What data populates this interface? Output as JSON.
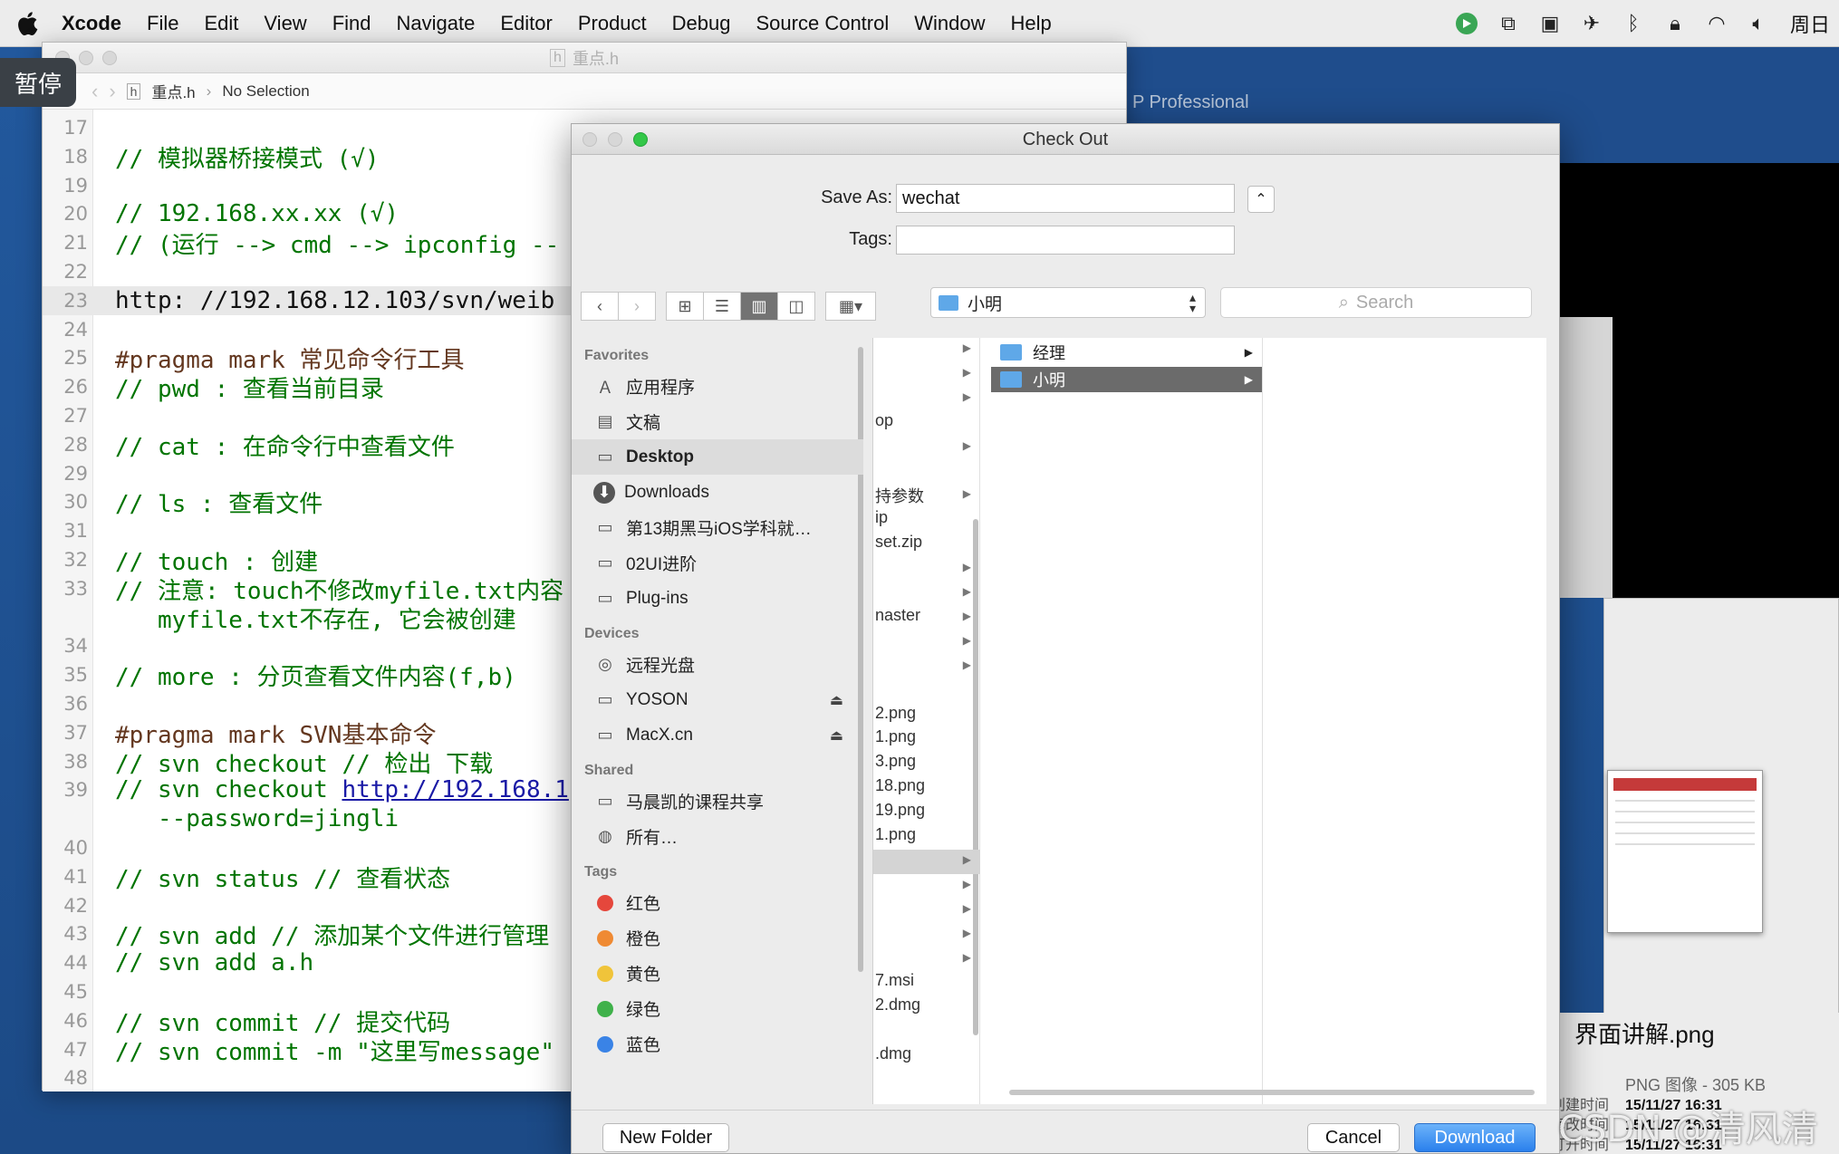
{
  "menubar": {
    "app_name": "Xcode",
    "items": [
      "File",
      "Edit",
      "View",
      "Find",
      "Navigate",
      "Editor",
      "Product",
      "Debug",
      "Source Control",
      "Window",
      "Help"
    ],
    "clock": "周日"
  },
  "pause_badge": "暂停",
  "xcode": {
    "window_title": "重点.h",
    "jumpbar_file": "重点.h",
    "jumpbar_selection": "No Selection",
    "lines": [
      {
        "n": "17",
        "t": ""
      },
      {
        "n": "18",
        "t": "// 模拟器桥接模式 (√)"
      },
      {
        "n": "19",
        "t": ""
      },
      {
        "n": "20",
        "t": "// 192.168.xx.xx (√)"
      },
      {
        "n": "21",
        "t": "// (运行 --> cmd --> ipconfig --"
      },
      {
        "n": "22",
        "t": ""
      },
      {
        "n": "23",
        "t": "http: //192.168.12.103/svn/weib",
        "hl": true
      },
      {
        "n": "24",
        "t": ""
      },
      {
        "n": "25",
        "t": "#pragma mark 常见命令行工具",
        "pragma": true
      },
      {
        "n": "26",
        "t": "// pwd : 查看当前目录"
      },
      {
        "n": "27",
        "t": ""
      },
      {
        "n": "28",
        "t": "// cat : 在命令行中查看文件"
      },
      {
        "n": "29",
        "t": ""
      },
      {
        "n": "30",
        "t": "// ls : 查看文件"
      },
      {
        "n": "31",
        "t": ""
      },
      {
        "n": "32",
        "t": "// touch : 创建"
      },
      {
        "n": "33",
        "t": "// 注意: touch不修改myfile.txt内容"
      },
      {
        "n": "",
        "t": "   myfile.txt不存在, 它会被创建",
        "cont": true
      },
      {
        "n": "34",
        "t": ""
      },
      {
        "n": "35",
        "t": "// more : 分页查看文件内容(f,b)"
      },
      {
        "n": "36",
        "t": ""
      },
      {
        "n": "37",
        "t": "#pragma mark SVN基本命令",
        "pragma": true
      },
      {
        "n": "38",
        "t": "// svn checkout // 检出 下载"
      },
      {
        "n": "39",
        "t": "// svn checkout ",
        "url": "http://192.168.1"
      },
      {
        "n": "",
        "t": "   --password=jingli",
        "cont": true
      },
      {
        "n": "40",
        "t": ""
      },
      {
        "n": "41",
        "t": "// svn status // 查看状态"
      },
      {
        "n": "42",
        "t": ""
      },
      {
        "n": "43",
        "t": "// svn add // 添加某个文件进行管理"
      },
      {
        "n": "44",
        "t": "// svn add a.h"
      },
      {
        "n": "45",
        "t": ""
      },
      {
        "n": "46",
        "t": "// svn commit // 提交代码"
      },
      {
        "n": "47",
        "t": "// svn commit -m \"这里写message\""
      },
      {
        "n": "48",
        "t": ""
      }
    ]
  },
  "background": {
    "window_label": "P Professional",
    "finder_file_name": "界面讲解.png",
    "finder_file_meta": "PNG 图像 - 305 KB",
    "finder_dates": [
      {
        "k": "创建时间",
        "v": "15/11/27 16:31"
      },
      {
        "k": "修改时间",
        "v": "15/11/27 16:31"
      },
      {
        "k": "打开时间",
        "v": "15/11/27 16:31"
      }
    ],
    "watermark": "CSDN @清风清晨"
  },
  "dialog": {
    "title": "Check Out",
    "save_as_label": "Save As:",
    "save_as_value": "wechat",
    "tags_label": "Tags:",
    "tags_value": "",
    "path_popup": "小明",
    "search_placeholder": "Search",
    "sidebar": {
      "favorites_header": "Favorites",
      "favorites": [
        {
          "label": "应用程序",
          "icon": "applications-icon"
        },
        {
          "label": "文稿",
          "icon": "documents-icon"
        },
        {
          "label": "Desktop",
          "icon": "desktop-icon",
          "selected": true
        },
        {
          "label": "Downloads",
          "icon": "downloads-icon"
        },
        {
          "label": "第13期黑马iOS学科就…",
          "icon": "folder-icon"
        },
        {
          "label": "02UI进阶",
          "icon": "folder-icon"
        },
        {
          "label": "Plug-ins",
          "icon": "folder-icon"
        }
      ],
      "devices_header": "Devices",
      "devices": [
        {
          "label": "远程光盘",
          "icon": "disc-icon"
        },
        {
          "label": "YOSON",
          "icon": "drive-icon",
          "eject": true
        },
        {
          "label": "MacX.cn",
          "icon": "drive-icon",
          "eject": true
        }
      ],
      "shared_header": "Shared",
      "shared": [
        {
          "label": "马晨凯的课程共享",
          "icon": "computer-icon"
        },
        {
          "label": "所有…",
          "icon": "network-icon"
        }
      ],
      "tags_header": "Tags",
      "tags": [
        {
          "label": "红色",
          "color": "#e5473c"
        },
        {
          "label": "橙色",
          "color": "#ef8a33"
        },
        {
          "label": "黄色",
          "color": "#f0c43a"
        },
        {
          "label": "绿色",
          "color": "#3fb14a"
        },
        {
          "label": "蓝色",
          "color": "#3a83e6"
        }
      ]
    },
    "column1": [
      {
        "t": "",
        "chev": true
      },
      {
        "t": "",
        "chev": true
      },
      {
        "t": "",
        "chev": true
      },
      {
        "t": "op",
        "chev": false
      },
      {
        "t": "",
        "chev": true
      },
      {
        "t": "",
        "chev": false
      },
      {
        "t": "持参数",
        "chev": true
      },
      {
        "t": "ip",
        "chev": false
      },
      {
        "t": "set.zip",
        "chev": false
      },
      {
        "t": "",
        "chev": true
      },
      {
        "t": "",
        "chev": true
      },
      {
        "t": "naster",
        "chev": true
      },
      {
        "t": "",
        "chev": true
      },
      {
        "t": "",
        "chev": true
      },
      {
        "t": "",
        "chev": false
      },
      {
        "t": "2.png",
        "chev": false
      },
      {
        "t": "1.png",
        "chev": false
      },
      {
        "t": "3.png",
        "chev": false
      },
      {
        "t": "18.png",
        "chev": false
      },
      {
        "t": "19.png",
        "chev": false
      },
      {
        "t": "1.png",
        "chev": false
      },
      {
        "t": "",
        "chev": true,
        "sel": true
      },
      {
        "t": "",
        "chev": true
      },
      {
        "t": "",
        "chev": true
      },
      {
        "t": "",
        "chev": true
      },
      {
        "t": "",
        "chev": true
      },
      {
        "t": "7.msi",
        "chev": false
      },
      {
        "t": "2.dmg",
        "chev": false
      },
      {
        "t": "",
        "chev": false
      },
      {
        "t": ".dmg",
        "chev": false
      }
    ],
    "column2": [
      {
        "label": "经理",
        "selected": false
      },
      {
        "label": "小明",
        "selected": true
      }
    ],
    "new_folder_label": "New Folder",
    "cancel_label": "Cancel",
    "download_label": "Download"
  }
}
